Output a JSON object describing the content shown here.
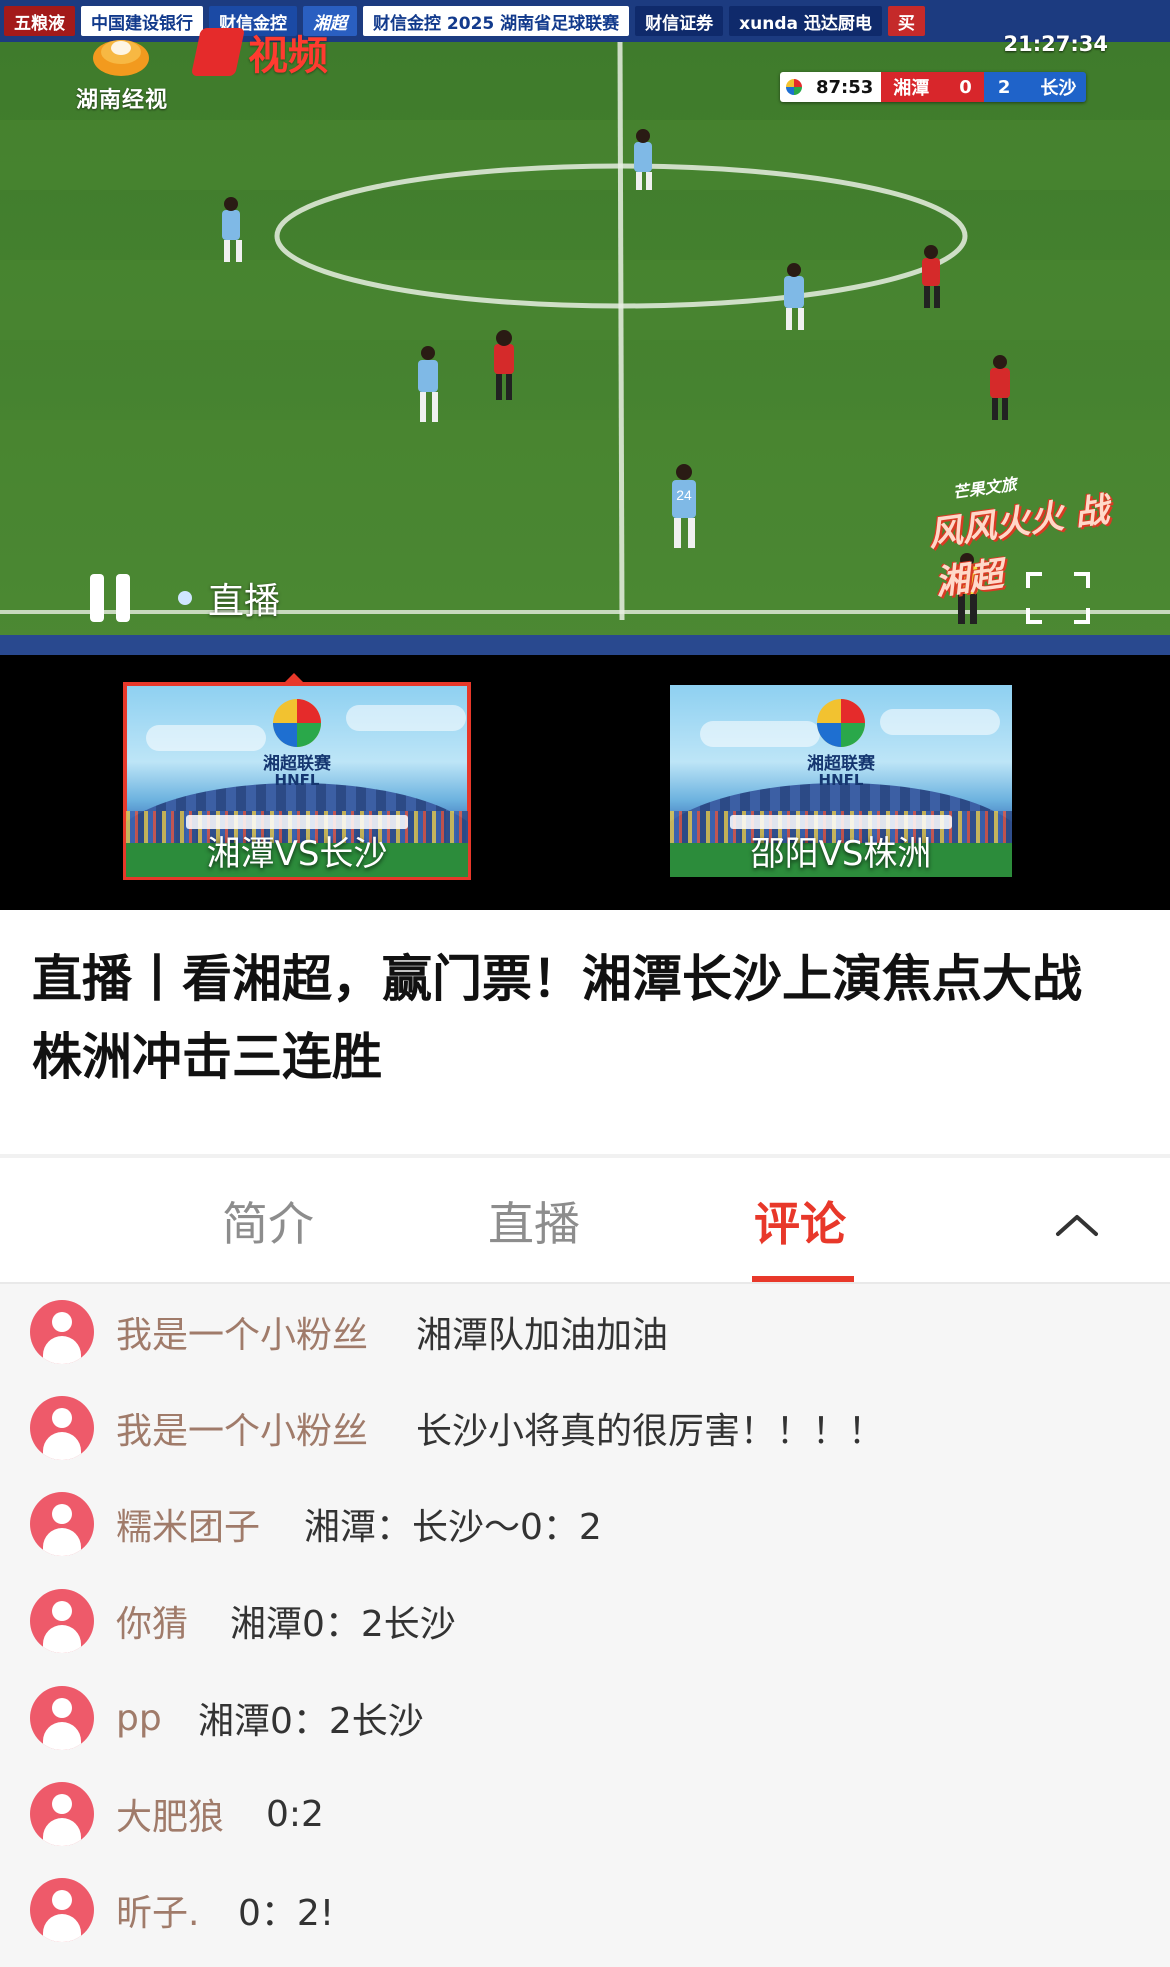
{
  "video": {
    "channel_logo_text": "湖南经视",
    "video_brand_text": "视频",
    "clock": "21:27:34",
    "scoreboard": {
      "time": "87:53",
      "home_team": "湘潭",
      "home_score": "0",
      "away_score": "2",
      "away_team": "长沙"
    },
    "adboards": [
      "五粮液",
      "中国建设银行",
      "财信金控",
      "湘超",
      "财信金控 2025 湖南省足球联赛",
      "财信证券",
      "xunda 迅达厨电",
      "买"
    ],
    "watermark_top": "芒果文旅",
    "watermark_main": "风风火火 战湘超",
    "live_label": "直播",
    "player_number": "24"
  },
  "matches": [
    {
      "league": "湘超联赛",
      "league_en": "HNFL",
      "caption": "湘潭VS长沙",
      "active": true
    },
    {
      "league": "湘超联赛",
      "league_en": "HNFL",
      "caption": "邵阳VS株洲",
      "active": false
    }
  ],
  "article": {
    "title": "直播丨看湘超，赢门票！湘潭长沙上演焦点大战 株洲冲击三连胜"
  },
  "tabs": [
    {
      "label": "简介"
    },
    {
      "label": "直播"
    },
    {
      "label": "评论"
    }
  ],
  "active_tab": "评论",
  "comments": [
    {
      "user": "我是一个小粉丝",
      "text": "湘潭队加油加油"
    },
    {
      "user": "我是一个小粉丝",
      "text": "长沙小将真的很厉害！！！！"
    },
    {
      "user": "糯米团子",
      "text": "湘潭：长沙～0：2"
    },
    {
      "user": "你猜",
      "text": "湘潭0：2长沙"
    },
    {
      "user": "pp",
      "text": "湘潭0：2长沙"
    },
    {
      "user": "大肥狼",
      "text": "0:2"
    },
    {
      "user": "昕子.",
      "text": "0：2!"
    }
  ],
  "colors": {
    "accent": "#e8382a",
    "username": "#a07b6a",
    "avatar": "#ee5a6a",
    "tab_inactive": "#8d8d8d"
  }
}
